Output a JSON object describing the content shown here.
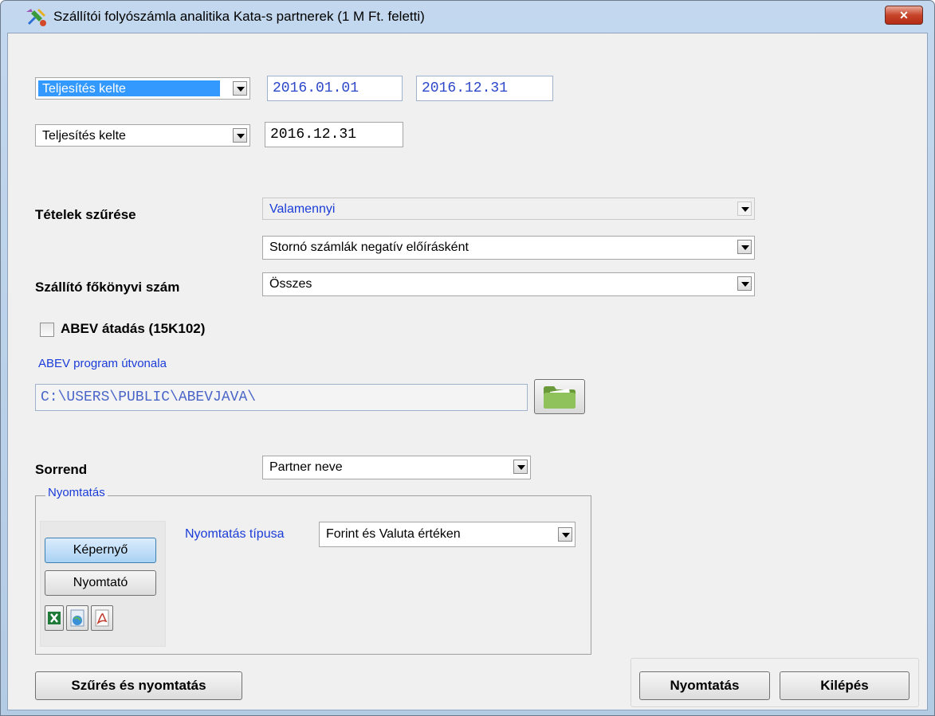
{
  "window": {
    "title": "Szállítói folyószámla analitika Kata-s partnerek (1 M Ft. feletti)",
    "close_label": "✕"
  },
  "date_filter": {
    "type_value": "Teljesítés kelte",
    "from": "2016.01.01",
    "to": "2016.12.31"
  },
  "date_filter2": {
    "type_value": "Teljesítés kelte",
    "date": "2016.12.31"
  },
  "filter": {
    "label": "Tételek szűrése",
    "select1_value": "Valamennyi",
    "select2_value": "Stornó számlák negatív előírásként"
  },
  "ledger": {
    "label": "Szállító főkönyvi szám",
    "value": "Összes"
  },
  "abev": {
    "checkbox_label": "ABEV átadás (15K102)",
    "checked": false,
    "path_label": "ABEV program útvonala",
    "path_value": "C:\\USERS\\PUBLIC\\ABEVJAVA\\"
  },
  "order": {
    "label": "Sorrend",
    "value": "Partner neve"
  },
  "print_group": {
    "title": "Nyomtatás",
    "screen_button": "Képernyő",
    "printer_button": "Nyomtató",
    "type_label": "Nyomtatás típusa",
    "type_value": "Forint és Valuta értéken"
  },
  "footer": {
    "filter_print_button": "Szűrés és nyomtatás",
    "print_button": "Nyomtatás",
    "exit_button": "Kilépés"
  },
  "colors": {
    "accent_blue": "#1a3cd8",
    "selection_blue": "#3399ff",
    "date_text": "#2b47c9"
  }
}
